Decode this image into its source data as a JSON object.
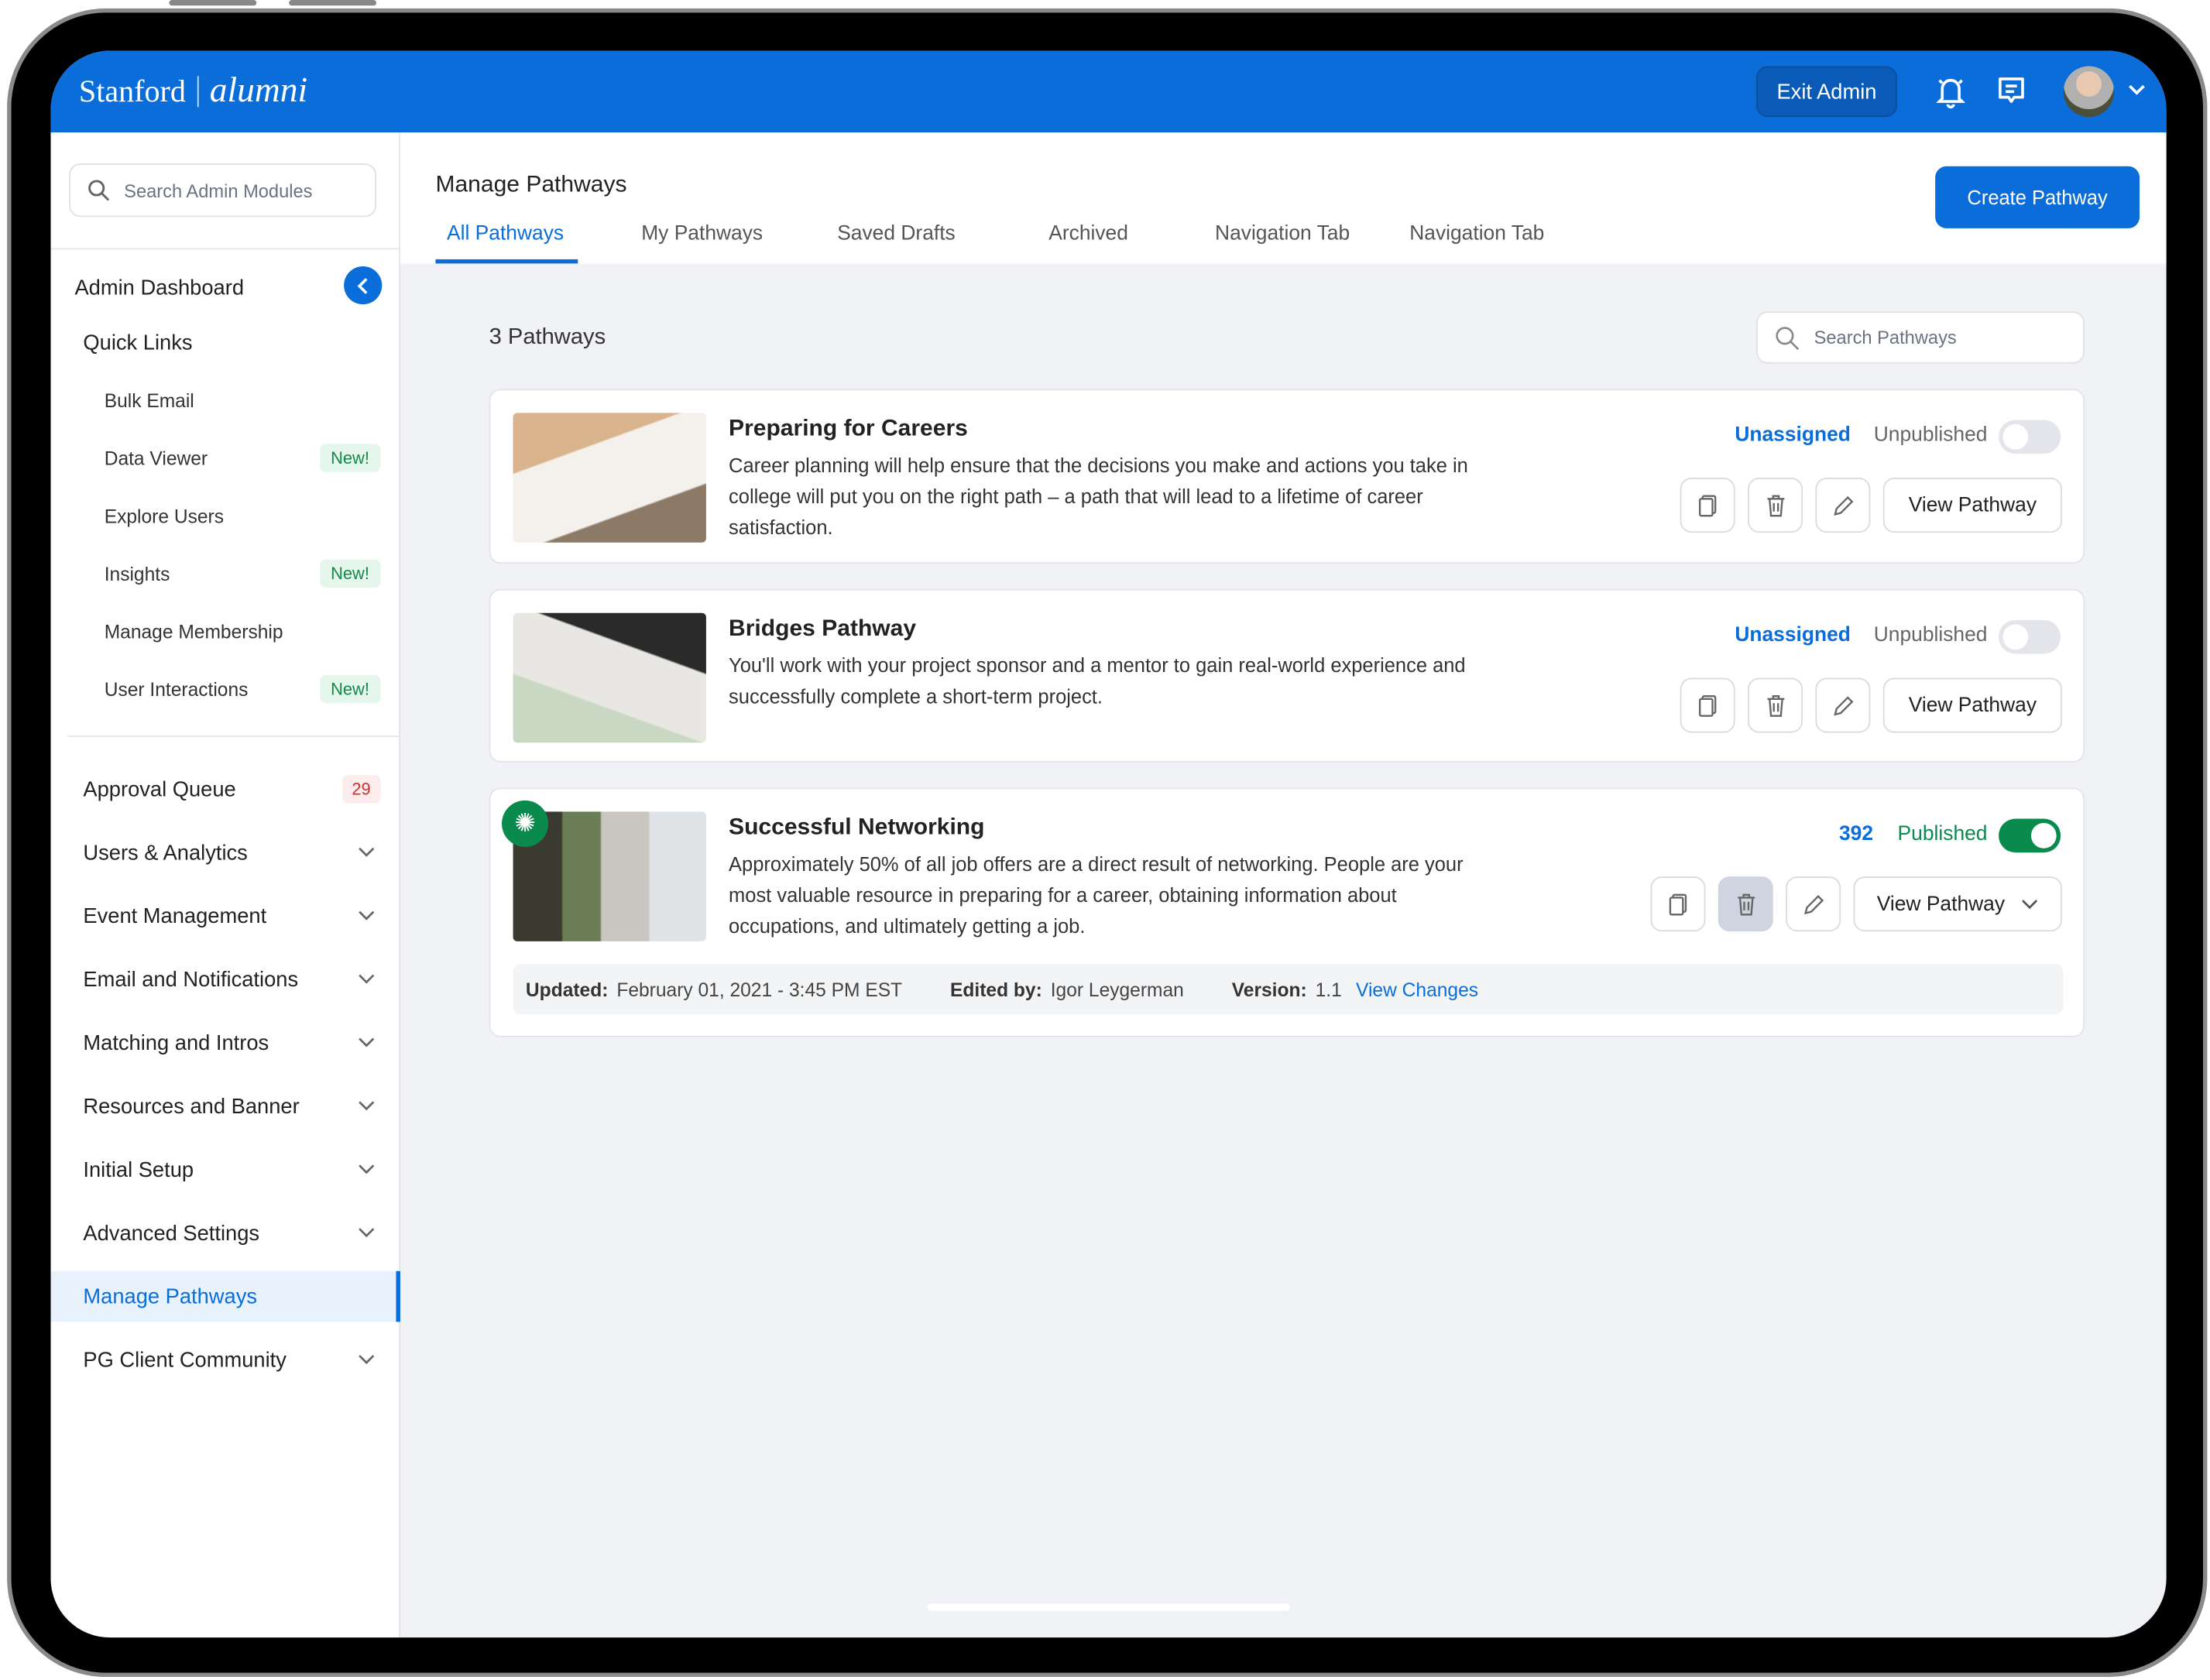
{
  "header": {
    "logo_primary": "Stanford",
    "logo_secondary": "alumni",
    "exit_admin": "Exit Admin"
  },
  "sidebar": {
    "search_placeholder": "Search Admin Modules",
    "dashboard": "Admin Dashboard",
    "quick_links": "Quick Links",
    "sub_items": [
      {
        "label": "Bulk Email"
      },
      {
        "label": "Data Viewer",
        "badge": "New!"
      },
      {
        "label": "Explore Users"
      },
      {
        "label": "Insights",
        "badge": "New!"
      },
      {
        "label": "Manage Membership"
      },
      {
        "label": "User Interactions",
        "badge": "New!"
      }
    ],
    "approval_queue": {
      "label": "Approval Queue",
      "count": "29"
    },
    "sections": [
      "Users & Analytics",
      "Event Management",
      "Email and Notifications",
      "Matching and Intros",
      "Resources and Banner",
      "Initial Setup",
      "Advanced Settings"
    ],
    "active": "Manage Pathways",
    "last": "PG Client Community"
  },
  "main": {
    "title": "Manage Pathways",
    "tabs": [
      "All Pathways",
      "My Pathways",
      "Saved Drafts",
      "Archived",
      "Navigation Tab",
      "Navigation Tab"
    ],
    "create_button": "Create Pathway",
    "count": "3 Pathways",
    "search_placeholder": "Search Pathways",
    "view_label": "View Pathway",
    "cards": [
      {
        "title": "Preparing for Careers",
        "description": "Career planning will help ensure that the decisions you make and actions you take in college will put you on the right path – a path that will lead to a lifetime of career satisfaction.",
        "assignment": "Unassigned",
        "status": "Unpublished",
        "published": false
      },
      {
        "title": "Bridges Pathway",
        "description": "You'll work with your project sponsor and a mentor to gain real-world experience and successfully complete a short-term project.",
        "assignment": "Unassigned",
        "status": "Unpublished",
        "published": false
      },
      {
        "title": "Successful Networking",
        "description": "Approximately 50% of all job offers are a direct result of networking. People are your most valuable resource in preparing for a career, obtaining information about occupations, and ultimately getting a job.",
        "assignment": "392",
        "status": "Published",
        "published": true,
        "meta": {
          "updated_label": "Updated:",
          "updated": "February 01, 2021 - 3:45 PM EST",
          "edited_label": "Edited by:",
          "edited": "Igor Leygerman",
          "version_label": "Version:",
          "version": "1.1",
          "changes": "View Changes"
        }
      }
    ]
  },
  "colors": {
    "brand": "#0b6dd9",
    "published": "#0b8a4e"
  }
}
